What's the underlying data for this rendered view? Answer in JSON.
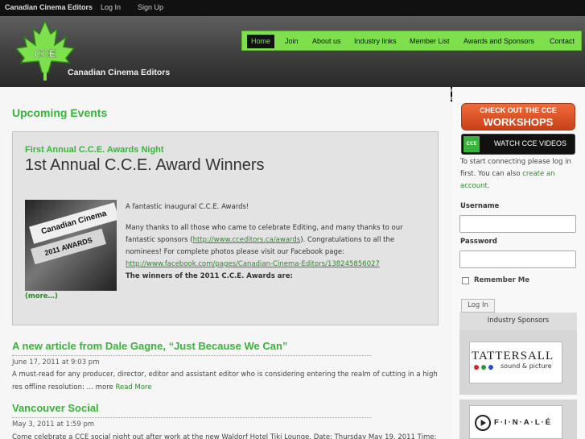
{
  "topbar": {
    "site_name": "Canadian Cinema Editors",
    "login": "Log In",
    "signup": "Sign Up"
  },
  "header": {
    "logo_text": "CCE",
    "brand_text": "Canadian Cinema Editors"
  },
  "nav": [
    "Home",
    "Join",
    "About us",
    "Industry links",
    "Member List",
    "Awards and Sponsors",
    "Contact"
  ],
  "main": {
    "heading": "Upcoming Events",
    "feature": {
      "kicker": "First Annual C.C.E. Awards Night",
      "title": "1st Annual C.C.E. Award Winners",
      "photo_sign1": "Canadian Cinema Editors",
      "photo_sign2": "2011 AWARDS",
      "p1": "A fantastic inaugural C.C.E. Awards!",
      "p2_a": "Many thanks to all those who came to celebrate Editing, and many thanks to our fantastic sponsors (",
      "p2_link": "http://www.cceditors.ca/awards",
      "p2_b": ").  Congratulations to all the nominees!  For complete photos please visit our Facebook page:",
      "p2_fb": "http://www.facebook.com/pages/Canadian-Cinema-Editors/138245856027",
      "p3": "The winners of the 2011 C.C.E. Awards are:",
      "more": "(more…)"
    },
    "posts": [
      {
        "title": "A new article from Dale Gagne, “Just Because We Can”",
        "date": "June 17, 2011 at 9:03 pm",
        "excerpt": "A must-read for any producer, director, editor and assistant editor who is considering entering the realm of cutting in a high res offline resolution: … more",
        "read_more": "Read More"
      },
      {
        "title": "Vancouver Social",
        "date": "May 3, 2011 at 1:59 pm",
        "excerpt": "Come celebrate a CCE social night out after work at the new Waldorf Hotel Tiki Lounge. Date:  Thursday May 19, 2011 Time:"
      }
    ]
  },
  "sidebar": {
    "workshops_l1": "CHECK OUT THE CCE",
    "workshops_l2": "WORKSHOPS",
    "videos_logo": "CCE",
    "videos": "WATCH CCE VIDEOS",
    "login_note_a": "To start connecting please log in first. You can also ",
    "login_note_link": "create an account",
    "login_note_b": ".",
    "username_label": "Username",
    "password_label": "Password",
    "remember_label": "Remember Me",
    "login_button": "Log In",
    "sponsors_heading": "Industry Sponsors",
    "sponsor1_name": "TATTERSALL",
    "sponsor1_sub": "sound & picture",
    "sponsor2_name": "F·I·N·A·L·É"
  },
  "colors": {
    "accent_green": "#7ee04c",
    "heading_green": "#39b33a",
    "workshops_orange": "#e25a2b"
  }
}
